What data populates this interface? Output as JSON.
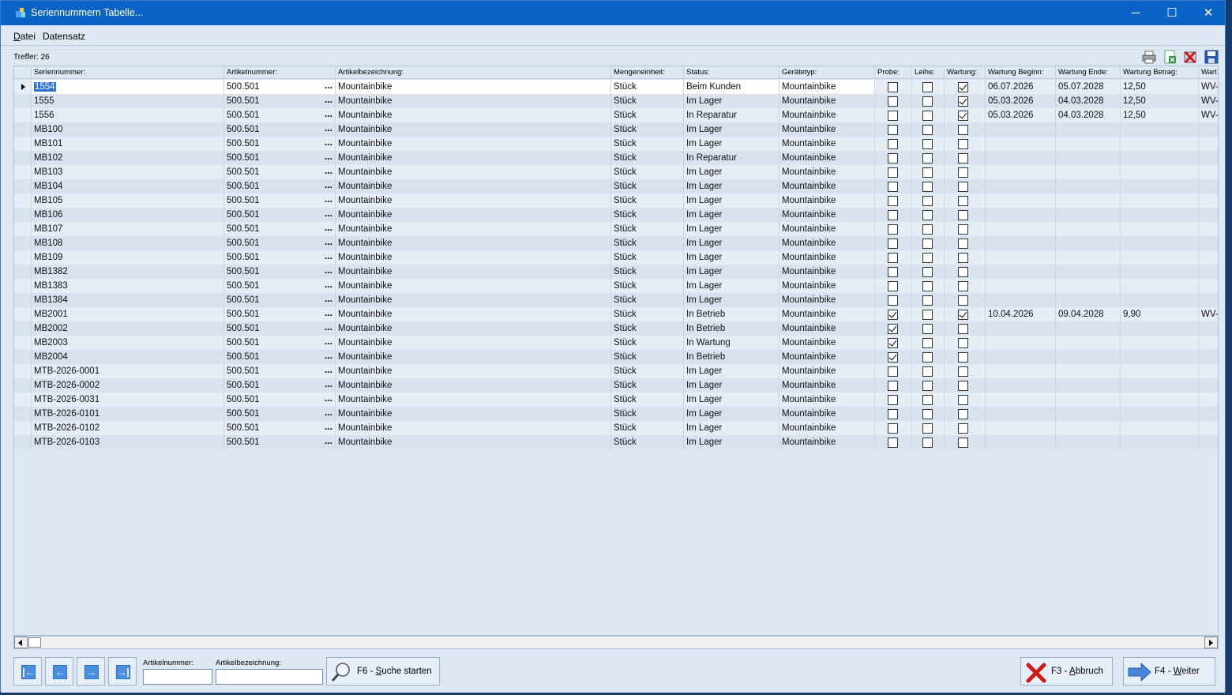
{
  "window": {
    "title": "Seriennummern Tabelle...",
    "minimize": "─",
    "maximize": "☐",
    "close": "✕"
  },
  "menu": {
    "datei": "Datei",
    "datensatz": "Datensatz"
  },
  "hits": "Treffer: 26",
  "toolbar_icons": [
    "printer-icon",
    "excel-export-icon",
    "delete-icon",
    "save-icon"
  ],
  "columns": [
    "Seriennummer:",
    "Artikelnummer:",
    "Artikelbezeichnung:",
    "Mengeneinheit:",
    "Status:",
    "Gerätetyp:",
    "Probe:",
    "Leihe:",
    "Wartung:",
    "Wartung Beginn:",
    "Wartung Ende:",
    "Wartung Betrag:",
    "Wart"
  ],
  "rows": [
    {
      "sn": "1554",
      "art": "500.501",
      "bez": "Mountainbike",
      "me": "Stück",
      "status": "Beim Kunden",
      "typ": "Mountainbike",
      "probe": false,
      "leihe": false,
      "wartung": true,
      "wb": "06.07.2026",
      "we": "05.07.2028",
      "betrag": "12,50",
      "wv": "WV-"
    },
    {
      "sn": "1555",
      "art": "500.501",
      "bez": "Mountainbike",
      "me": "Stück",
      "status": "Im Lager",
      "typ": "Mountainbike",
      "probe": false,
      "leihe": false,
      "wartung": true,
      "wb": "05.03.2026",
      "we": "04.03.2028",
      "betrag": "12,50",
      "wv": "WV-"
    },
    {
      "sn": "1556",
      "art": "500.501",
      "bez": "Mountainbike",
      "me": "Stück",
      "status": "In Reparatur",
      "typ": "Mountainbike",
      "probe": false,
      "leihe": false,
      "wartung": true,
      "wb": "05.03.2026",
      "we": "04.03.2028",
      "betrag": "12,50",
      "wv": "WV-"
    },
    {
      "sn": "MB100",
      "art": "500.501",
      "bez": "Mountainbike",
      "me": "Stück",
      "status": "Im Lager",
      "typ": "Mountainbike",
      "probe": false,
      "leihe": false,
      "wartung": false,
      "wb": "",
      "we": "",
      "betrag": "",
      "wv": ""
    },
    {
      "sn": "MB101",
      "art": "500.501",
      "bez": "Mountainbike",
      "me": "Stück",
      "status": "Im Lager",
      "typ": "Mountainbike",
      "probe": false,
      "leihe": false,
      "wartung": false,
      "wb": "",
      "we": "",
      "betrag": "",
      "wv": ""
    },
    {
      "sn": "MB102",
      "art": "500.501",
      "bez": "Mountainbike",
      "me": "Stück",
      "status": "In Reparatur",
      "typ": "Mountainbike",
      "probe": false,
      "leihe": false,
      "wartung": false,
      "wb": "",
      "we": "",
      "betrag": "",
      "wv": ""
    },
    {
      "sn": "MB103",
      "art": "500.501",
      "bez": "Mountainbike",
      "me": "Stück",
      "status": "Im Lager",
      "typ": "Mountainbike",
      "probe": false,
      "leihe": false,
      "wartung": false,
      "wb": "",
      "we": "",
      "betrag": "",
      "wv": ""
    },
    {
      "sn": "MB104",
      "art": "500.501",
      "bez": "Mountainbike",
      "me": "Stück",
      "status": "Im Lager",
      "typ": "Mountainbike",
      "probe": false,
      "leihe": false,
      "wartung": false,
      "wb": "",
      "we": "",
      "betrag": "",
      "wv": ""
    },
    {
      "sn": "MB105",
      "art": "500.501",
      "bez": "Mountainbike",
      "me": "Stück",
      "status": "Im Lager",
      "typ": "Mountainbike",
      "probe": false,
      "leihe": false,
      "wartung": false,
      "wb": "",
      "we": "",
      "betrag": "",
      "wv": ""
    },
    {
      "sn": "MB106",
      "art": "500.501",
      "bez": "Mountainbike",
      "me": "Stück",
      "status": "Im Lager",
      "typ": "Mountainbike",
      "probe": false,
      "leihe": false,
      "wartung": false,
      "wb": "",
      "we": "",
      "betrag": "",
      "wv": ""
    },
    {
      "sn": "MB107",
      "art": "500.501",
      "bez": "Mountainbike",
      "me": "Stück",
      "status": "Im Lager",
      "typ": "Mountainbike",
      "probe": false,
      "leihe": false,
      "wartung": false,
      "wb": "",
      "we": "",
      "betrag": "",
      "wv": ""
    },
    {
      "sn": "MB108",
      "art": "500.501",
      "bez": "Mountainbike",
      "me": "Stück",
      "status": "Im Lager",
      "typ": "Mountainbike",
      "probe": false,
      "leihe": false,
      "wartung": false,
      "wb": "",
      "we": "",
      "betrag": "",
      "wv": ""
    },
    {
      "sn": "MB109",
      "art": "500.501",
      "bez": "Mountainbike",
      "me": "Stück",
      "status": "Im Lager",
      "typ": "Mountainbike",
      "probe": false,
      "leihe": false,
      "wartung": false,
      "wb": "",
      "we": "",
      "betrag": "",
      "wv": ""
    },
    {
      "sn": "MB1382",
      "art": "500.501",
      "bez": "Mountainbike",
      "me": "Stück",
      "status": "Im Lager",
      "typ": "Mountainbike",
      "probe": false,
      "leihe": false,
      "wartung": false,
      "wb": "",
      "we": "",
      "betrag": "",
      "wv": ""
    },
    {
      "sn": "MB1383",
      "art": "500.501",
      "bez": "Mountainbike",
      "me": "Stück",
      "status": "Im Lager",
      "typ": "Mountainbike",
      "probe": false,
      "leihe": false,
      "wartung": false,
      "wb": "",
      "we": "",
      "betrag": "",
      "wv": ""
    },
    {
      "sn": "MB1384",
      "art": "500.501",
      "bez": "Mountainbike",
      "me": "Stück",
      "status": "Im Lager",
      "typ": "Mountainbike",
      "probe": false,
      "leihe": false,
      "wartung": false,
      "wb": "",
      "we": "",
      "betrag": "",
      "wv": ""
    },
    {
      "sn": "MB2001",
      "art": "500.501",
      "bez": "Mountainbike",
      "me": "Stück",
      "status": "In Betrieb",
      "typ": "Mountainbike",
      "probe": true,
      "leihe": false,
      "wartung": true,
      "wb": "10.04.2026",
      "we": "09.04.2028",
      "betrag": "9,90",
      "wv": "WV-"
    },
    {
      "sn": "MB2002",
      "art": "500.501",
      "bez": "Mountainbike",
      "me": "Stück",
      "status": "In Betrieb",
      "typ": "Mountainbike",
      "probe": true,
      "leihe": false,
      "wartung": false,
      "wb": "",
      "we": "",
      "betrag": "",
      "wv": ""
    },
    {
      "sn": "MB2003",
      "art": "500.501",
      "bez": "Mountainbike",
      "me": "Stück",
      "status": "In Wartung",
      "typ": "Mountainbike",
      "probe": true,
      "leihe": false,
      "wartung": false,
      "wb": "",
      "we": "",
      "betrag": "",
      "wv": ""
    },
    {
      "sn": "MB2004",
      "art": "500.501",
      "bez": "Mountainbike",
      "me": "Stück",
      "status": "In Betrieb",
      "typ": "Mountainbike",
      "probe": true,
      "leihe": false,
      "wartung": false,
      "wb": "",
      "we": "",
      "betrag": "",
      "wv": ""
    },
    {
      "sn": "MTB-2026-0001",
      "art": "500.501",
      "bez": "Mountainbike",
      "me": "Stück",
      "status": "Im Lager",
      "typ": "Mountainbike",
      "probe": false,
      "leihe": false,
      "wartung": false,
      "wb": "",
      "we": "",
      "betrag": "",
      "wv": ""
    },
    {
      "sn": "MTB-2026-0002",
      "art": "500.501",
      "bez": "Mountainbike",
      "me": "Stück",
      "status": "Im Lager",
      "typ": "Mountainbike",
      "probe": false,
      "leihe": false,
      "wartung": false,
      "wb": "",
      "we": "",
      "betrag": "",
      "wv": ""
    },
    {
      "sn": "MTB-2026-0031",
      "art": "500.501",
      "bez": "Mountainbike",
      "me": "Stück",
      "status": "Im Lager",
      "typ": "Mountainbike",
      "probe": false,
      "leihe": false,
      "wartung": false,
      "wb": "",
      "we": "",
      "betrag": "",
      "wv": ""
    },
    {
      "sn": "MTB-2026-0101",
      "art": "500.501",
      "bez": "Mountainbike",
      "me": "Stück",
      "status": "Im Lager",
      "typ": "Mountainbike",
      "probe": false,
      "leihe": false,
      "wartung": false,
      "wb": "",
      "we": "",
      "betrag": "",
      "wv": ""
    },
    {
      "sn": "MTB-2026-0102",
      "art": "500.501",
      "bez": "Mountainbike",
      "me": "Stück",
      "status": "Im Lager",
      "typ": "Mountainbike",
      "probe": false,
      "leihe": false,
      "wartung": false,
      "wb": "",
      "we": "",
      "betrag": "",
      "wv": ""
    },
    {
      "sn": "MTB-2026-0103",
      "art": "500.501",
      "bez": "Mountainbike",
      "me": "Stück",
      "status": "Im Lager",
      "typ": "Mountainbike",
      "probe": false,
      "leihe": false,
      "wartung": false,
      "wb": "",
      "we": "",
      "betrag": "",
      "wv": ""
    }
  ],
  "ellipsis": "...",
  "filter": {
    "artikelnummer_label": "Artikelnummer:",
    "artikelnummer_value": "",
    "artikelbezeichnung_label": "Artikelbezeichnung:",
    "artikelbezeichnung_value": ""
  },
  "buttons": {
    "search_prefix": "F6 - ",
    "search_key": "S",
    "search_rest": "uche starten",
    "cancel_prefix": "F3 - ",
    "cancel_key": "A",
    "cancel_rest": "bbruch",
    "next_prefix": "F4 - ",
    "next_key": "W",
    "next_rest": "eiter"
  },
  "colors": {
    "titlebar": "#0a64c8",
    "window_bg": "#dde8f3",
    "selection": "#3372d6",
    "row_odd": "#e4ecf5",
    "row_even": "#d8e3ef"
  }
}
